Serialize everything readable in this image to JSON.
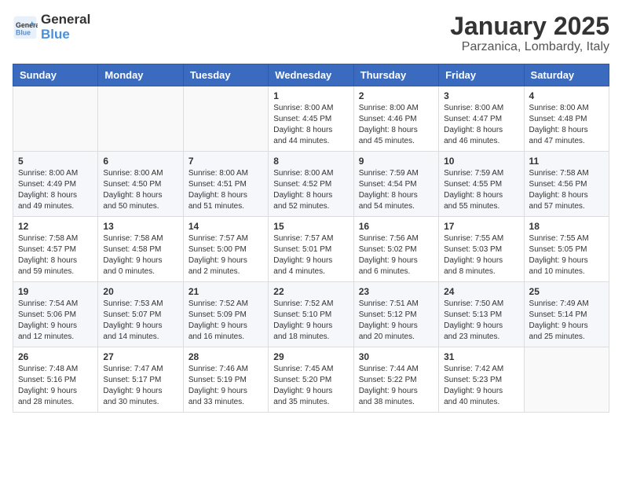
{
  "header": {
    "logo_line1": "General",
    "logo_line2": "Blue",
    "title": "January 2025",
    "subtitle": "Parzanica, Lombardy, Italy"
  },
  "weekdays": [
    "Sunday",
    "Monday",
    "Tuesday",
    "Wednesday",
    "Thursday",
    "Friday",
    "Saturday"
  ],
  "weeks": [
    [
      {
        "day": "",
        "info": ""
      },
      {
        "day": "",
        "info": ""
      },
      {
        "day": "",
        "info": ""
      },
      {
        "day": "1",
        "info": "Sunrise: 8:00 AM\nSunset: 4:45 PM\nDaylight: 8 hours\nand 44 minutes."
      },
      {
        "day": "2",
        "info": "Sunrise: 8:00 AM\nSunset: 4:46 PM\nDaylight: 8 hours\nand 45 minutes."
      },
      {
        "day": "3",
        "info": "Sunrise: 8:00 AM\nSunset: 4:47 PM\nDaylight: 8 hours\nand 46 minutes."
      },
      {
        "day": "4",
        "info": "Sunrise: 8:00 AM\nSunset: 4:48 PM\nDaylight: 8 hours\nand 47 minutes."
      }
    ],
    [
      {
        "day": "5",
        "info": "Sunrise: 8:00 AM\nSunset: 4:49 PM\nDaylight: 8 hours\nand 49 minutes."
      },
      {
        "day": "6",
        "info": "Sunrise: 8:00 AM\nSunset: 4:50 PM\nDaylight: 8 hours\nand 50 minutes."
      },
      {
        "day": "7",
        "info": "Sunrise: 8:00 AM\nSunset: 4:51 PM\nDaylight: 8 hours\nand 51 minutes."
      },
      {
        "day": "8",
        "info": "Sunrise: 8:00 AM\nSunset: 4:52 PM\nDaylight: 8 hours\nand 52 minutes."
      },
      {
        "day": "9",
        "info": "Sunrise: 7:59 AM\nSunset: 4:54 PM\nDaylight: 8 hours\nand 54 minutes."
      },
      {
        "day": "10",
        "info": "Sunrise: 7:59 AM\nSunset: 4:55 PM\nDaylight: 8 hours\nand 55 minutes."
      },
      {
        "day": "11",
        "info": "Sunrise: 7:58 AM\nSunset: 4:56 PM\nDaylight: 8 hours\nand 57 minutes."
      }
    ],
    [
      {
        "day": "12",
        "info": "Sunrise: 7:58 AM\nSunset: 4:57 PM\nDaylight: 8 hours\nand 59 minutes."
      },
      {
        "day": "13",
        "info": "Sunrise: 7:58 AM\nSunset: 4:58 PM\nDaylight: 9 hours\nand 0 minutes."
      },
      {
        "day": "14",
        "info": "Sunrise: 7:57 AM\nSunset: 5:00 PM\nDaylight: 9 hours\nand 2 minutes."
      },
      {
        "day": "15",
        "info": "Sunrise: 7:57 AM\nSunset: 5:01 PM\nDaylight: 9 hours\nand 4 minutes."
      },
      {
        "day": "16",
        "info": "Sunrise: 7:56 AM\nSunset: 5:02 PM\nDaylight: 9 hours\nand 6 minutes."
      },
      {
        "day": "17",
        "info": "Sunrise: 7:55 AM\nSunset: 5:03 PM\nDaylight: 9 hours\nand 8 minutes."
      },
      {
        "day": "18",
        "info": "Sunrise: 7:55 AM\nSunset: 5:05 PM\nDaylight: 9 hours\nand 10 minutes."
      }
    ],
    [
      {
        "day": "19",
        "info": "Sunrise: 7:54 AM\nSunset: 5:06 PM\nDaylight: 9 hours\nand 12 minutes."
      },
      {
        "day": "20",
        "info": "Sunrise: 7:53 AM\nSunset: 5:07 PM\nDaylight: 9 hours\nand 14 minutes."
      },
      {
        "day": "21",
        "info": "Sunrise: 7:52 AM\nSunset: 5:09 PM\nDaylight: 9 hours\nand 16 minutes."
      },
      {
        "day": "22",
        "info": "Sunrise: 7:52 AM\nSunset: 5:10 PM\nDaylight: 9 hours\nand 18 minutes."
      },
      {
        "day": "23",
        "info": "Sunrise: 7:51 AM\nSunset: 5:12 PM\nDaylight: 9 hours\nand 20 minutes."
      },
      {
        "day": "24",
        "info": "Sunrise: 7:50 AM\nSunset: 5:13 PM\nDaylight: 9 hours\nand 23 minutes."
      },
      {
        "day": "25",
        "info": "Sunrise: 7:49 AM\nSunset: 5:14 PM\nDaylight: 9 hours\nand 25 minutes."
      }
    ],
    [
      {
        "day": "26",
        "info": "Sunrise: 7:48 AM\nSunset: 5:16 PM\nDaylight: 9 hours\nand 28 minutes."
      },
      {
        "day": "27",
        "info": "Sunrise: 7:47 AM\nSunset: 5:17 PM\nDaylight: 9 hours\nand 30 minutes."
      },
      {
        "day": "28",
        "info": "Sunrise: 7:46 AM\nSunset: 5:19 PM\nDaylight: 9 hours\nand 33 minutes."
      },
      {
        "day": "29",
        "info": "Sunrise: 7:45 AM\nSunset: 5:20 PM\nDaylight: 9 hours\nand 35 minutes."
      },
      {
        "day": "30",
        "info": "Sunrise: 7:44 AM\nSunset: 5:22 PM\nDaylight: 9 hours\nand 38 minutes."
      },
      {
        "day": "31",
        "info": "Sunrise: 7:42 AM\nSunset: 5:23 PM\nDaylight: 9 hours\nand 40 minutes."
      },
      {
        "day": "",
        "info": ""
      }
    ]
  ]
}
